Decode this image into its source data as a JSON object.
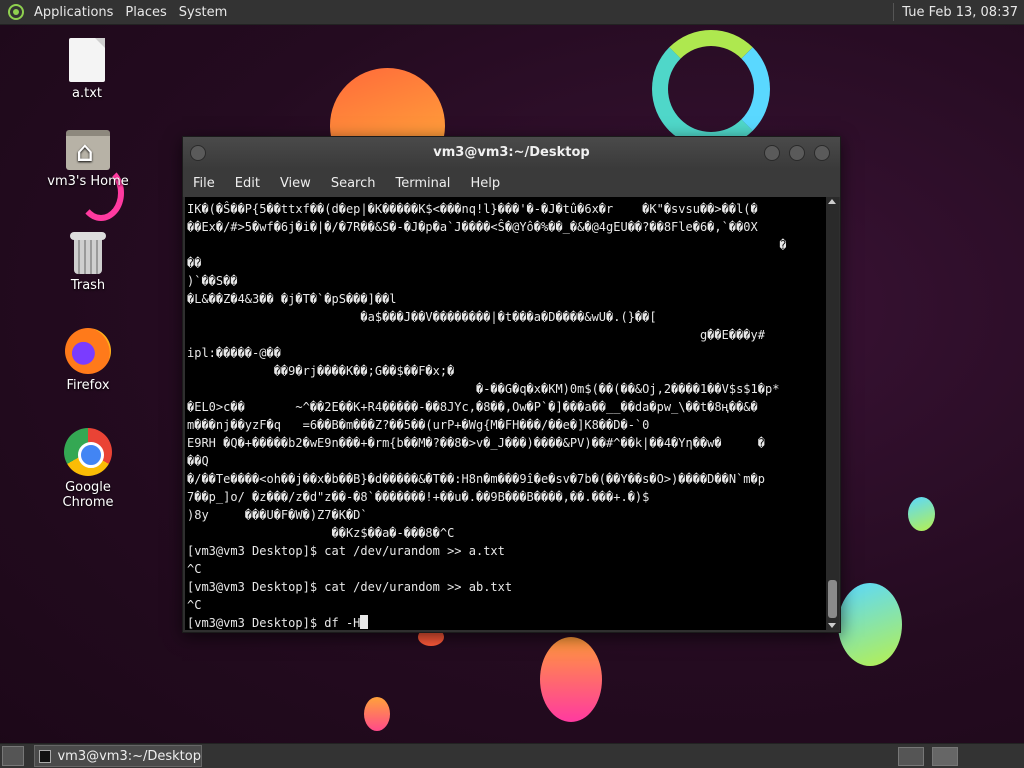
{
  "top_panel": {
    "menus": [
      "Applications",
      "Places",
      "System"
    ],
    "clock": "Tue Feb 13, 08:37"
  },
  "desktop_icons": [
    {
      "label": "a.txt",
      "icon": "text-file-icon"
    },
    {
      "label": "vm3's Home",
      "icon": "home-folder-icon"
    },
    {
      "label": "Trash",
      "icon": "trash-icon"
    },
    {
      "label": "Firefox",
      "icon": "firefox-icon"
    },
    {
      "label": "Google Chrome",
      "icon": "chrome-icon"
    }
  ],
  "terminal": {
    "title": "vm3@vm3:~/Desktop",
    "menu": [
      "File",
      "Edit",
      "View",
      "Search",
      "Terminal",
      "Help"
    ],
    "lines": [
      "IK�(�Ŝ��P{5��ttxf��(d�ep|�K�����K$<���nq!l}���'�-�J�tû�6x�r    �K\"�svsu��>��l(�",
      "��Ex�/#>5�wf�6j�i�|�/�7R��&S�-�J�p�a`J����<Ŝ�@Yô�%��_�&�@4gEU��?��8Fle�6�,`��0X",
      "                                                                                  �",
      "��",
      ")`��S��",
      "�L&��Z�4&3�� �j�T�`�pS���]��l",
      "                        �a$���J��V��������|�t���a�D����&wU�.(}��[",
      "                                                                       g��E���y#",
      "ipl:�����-@��",
      "            ��9�rj����K��;G��$��F�x;�",
      "                                        �-��G�q�x�KM)0m$(��(��&Oj,2����1��V$s$1�p*",
      "�EL0>c��       ~^��2E��K+R4�����-��8JYc,�8��,Ow�P`�]���a��__��da�pw_\\��t�8ң��&�",
      "m���nj��yzF�q   =6��B�m���Z?��5��(urP+�Wg{M�FH���/��e�]K8��D�-`0",
      "E9RH �Q�+�����b2�wE9n���+�rm{b��M�?��8�>v�_J���)����&PV)��#^��k|��4�Yη��w�     �",
      "��Q",
      "�/��Te����<oh��j��x�b��B}�d�����&�T��:H8n�m���9î�e�sv�7b�(��Y��s�O>)����D��N`m�p",
      "7��p_]o/ �z���/z�d\"z��-�8`�������!+��u�.��9B���B����,��.���+.�)$",
      ")8y     ���U�F�W�)Z7�K�D`",
      "                    ��Kz$��a�-���8�^C",
      "[vm3@vm3 Desktop]$ cat /dev/urandom >> a.txt",
      "^C",
      "[vm3@vm3 Desktop]$ cat /dev/urandom >> ab.txt",
      "^C"
    ],
    "prompt": "[vm3@vm3 Desktop]$ ",
    "current_input": "df -H"
  },
  "bottom_panel": {
    "task": "vm3@vm3:~/Desktop"
  }
}
